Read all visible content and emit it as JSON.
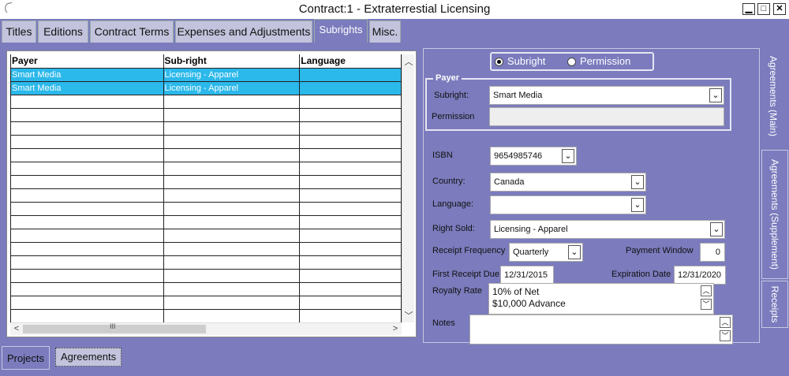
{
  "window": {
    "title": "Contract:1 - Extraterrestial Licensing",
    "minimize_glyph": "▁",
    "maximize_glyph": "□",
    "close_glyph": "✕"
  },
  "tabs": [
    {
      "label": "Titles"
    },
    {
      "label": "Editions"
    },
    {
      "label": "Contract Terms"
    },
    {
      "label": "Expenses and Adjustments"
    },
    {
      "label": "Subrights"
    },
    {
      "label": "Misc."
    }
  ],
  "grid": {
    "columns": [
      "Payer",
      "Sub-right",
      "Language"
    ],
    "rows": [
      [
        "Smart Media",
        "Licensing - Apparel",
        ""
      ],
      [
        "Smart Media",
        "Licensing - Apparel",
        ""
      ]
    ],
    "selected_color": "#2bb8ea",
    "scroll_thumb_glyph": "III"
  },
  "form": {
    "mode_options": [
      {
        "label": "Subright",
        "selected": true
      },
      {
        "label": "Permission",
        "selected": false
      }
    ],
    "payer_group": {
      "title": "Payer",
      "subright_label": "Subright:",
      "subright_value": "Smart Media",
      "permission_label": "Permission",
      "permission_value": ""
    },
    "isbn_label": "ISBN",
    "isbn_value": "9654985746",
    "country_label": "Country:",
    "country_value": "Canada",
    "language_label": "Language:",
    "language_value": "",
    "right_sold_label": "Right Sold:",
    "right_sold_value": "Licensing - Apparel",
    "receipt_frequency_label": "Receipt Frequency",
    "receipt_frequency_value": "Quarterly",
    "payment_window_label": "Payment Window",
    "payment_window_value": "0",
    "first_receipt_due_label": "First Receipt Due",
    "first_receipt_due_value": "12/31/2015",
    "expiration_date_label": "Expiration Date",
    "expiration_date_value": "12/31/2020",
    "royalty_rate_label": "Royalty Rate",
    "royalty_rate_lines": [
      "10% of Net",
      "$10,000 Advance"
    ],
    "notes_label": "Notes",
    "notes_value": ""
  },
  "side_tabs": [
    {
      "label": "Agreements (Main)"
    },
    {
      "label": "Agreements (Supplement)"
    },
    {
      "label": "Receipts"
    }
  ],
  "bottom_tabs": [
    {
      "label": "Projects"
    },
    {
      "label": "Agreements"
    }
  ],
  "colors": {
    "background": "#7b7bbd",
    "tab_inactive": "#c3c3dd",
    "selection": "#2bb8ea"
  }
}
